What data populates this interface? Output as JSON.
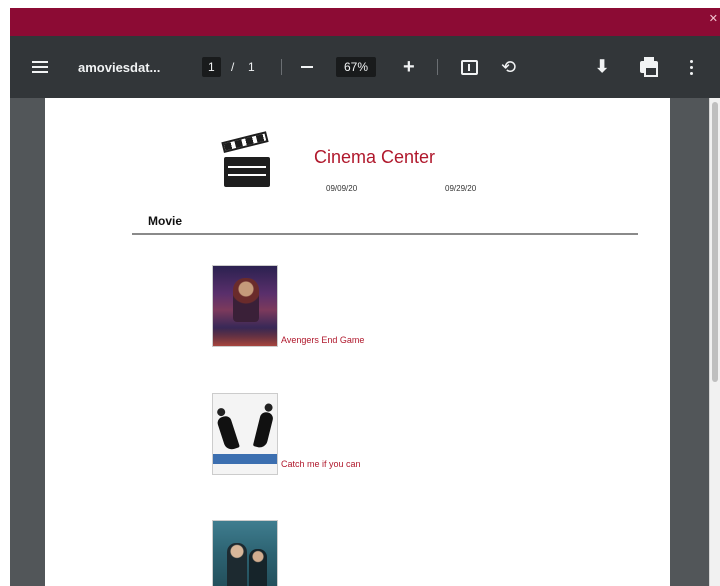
{
  "toolbar": {
    "doc_title": "amoviesdat...",
    "page_current": "1",
    "page_separator": "/",
    "page_total": "1",
    "zoom_value": "67%",
    "zoom_out_symbol": "—",
    "zoom_in_symbol": "+",
    "rotate_symbol": "⟲",
    "download_symbol": "⬇",
    "close_symbol": "✕"
  },
  "document": {
    "header_title": "Cinema Center",
    "date_start": "09/09/20",
    "date_end": "09/29/20",
    "section_label": "Movie",
    "movies": [
      {
        "title": "Avengers End Game"
      },
      {
        "title": "Catch me if you can"
      },
      {
        "title": ""
      }
    ]
  },
  "colors": {
    "title_strip": "#8c0b34",
    "toolbar_bg": "#323639",
    "viewer_bg": "#525659",
    "accent_text": "#b0182c"
  },
  "icons": [
    "menu-icon",
    "zoom-out-icon",
    "zoom-in-icon",
    "fit-page-icon",
    "rotate-icon",
    "download-icon",
    "print-icon",
    "more-options-icon",
    "clapperboard-icon"
  ]
}
